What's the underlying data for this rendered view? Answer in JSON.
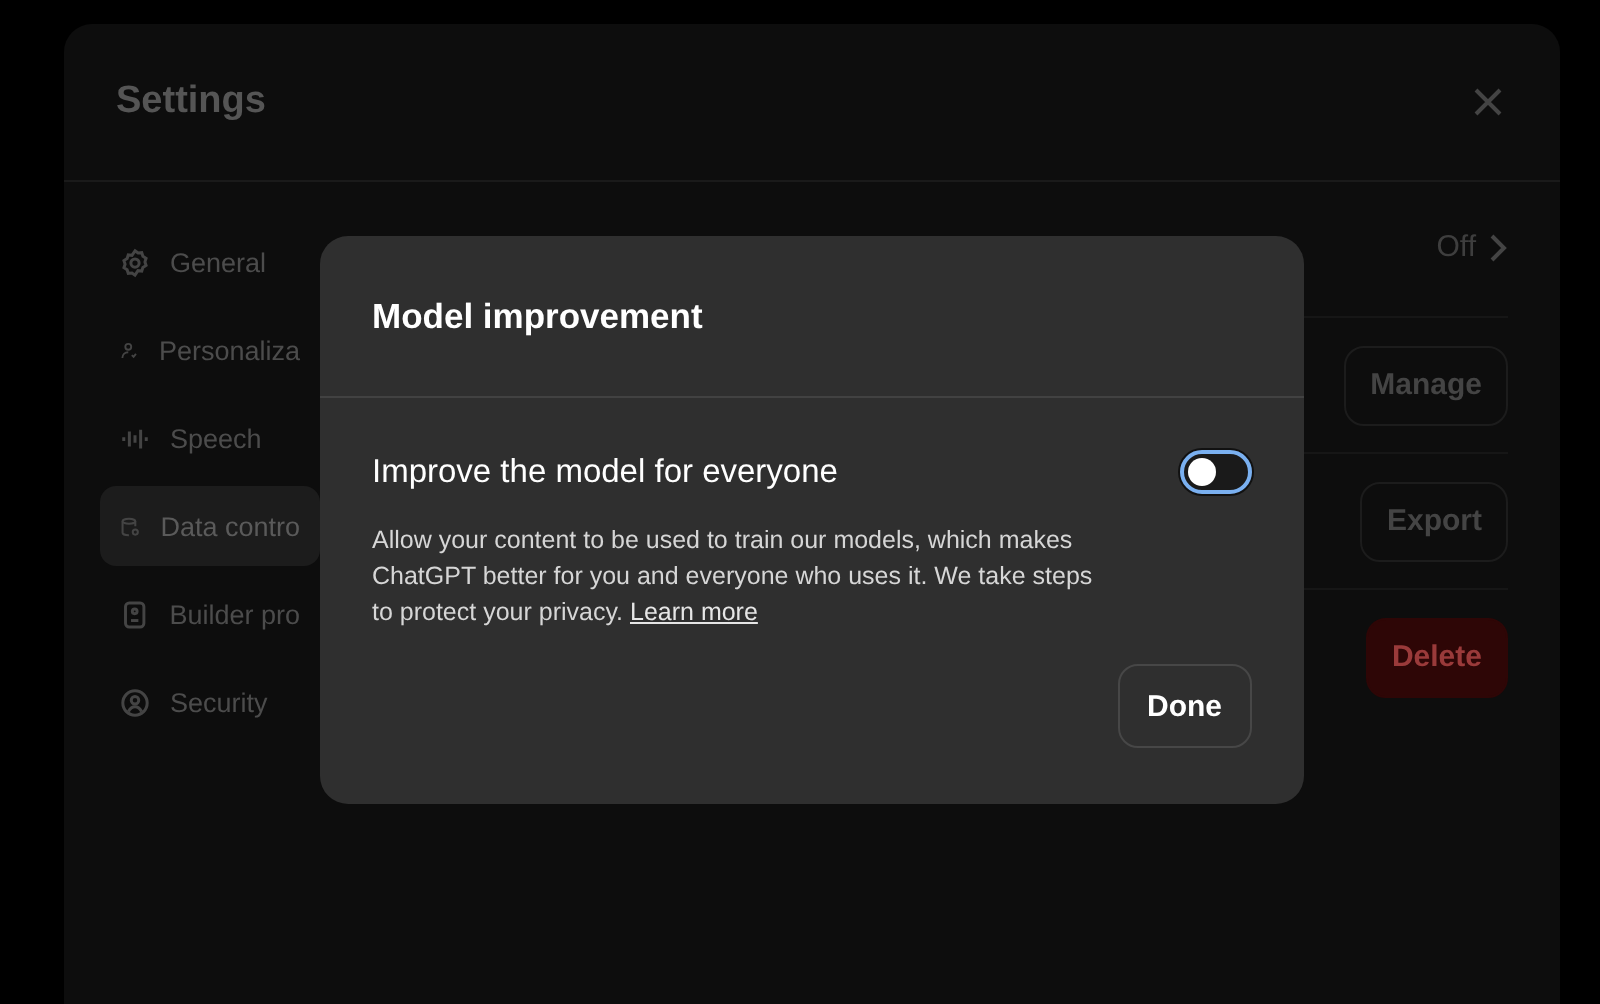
{
  "settings": {
    "title": "Settings",
    "sidebar": {
      "items": [
        {
          "label": "General",
          "selected": false
        },
        {
          "label": "Personaliza",
          "selected": false
        },
        {
          "label": "Speech",
          "selected": false
        },
        {
          "label": "Data contro",
          "selected": true
        },
        {
          "label": "Builder pro",
          "selected": false
        },
        {
          "label": "Security",
          "selected": false
        }
      ]
    },
    "rows": [
      {
        "kind": "link",
        "label": "Off"
      },
      {
        "kind": "button",
        "label": "Manage"
      },
      {
        "kind": "button",
        "label": "Export"
      },
      {
        "kind": "danger",
        "label": "Delete"
      }
    ]
  },
  "dialog": {
    "title": "Model improvement",
    "toggle": {
      "label": "Improve the model for everyone",
      "on": false
    },
    "description": "Allow your content to be used to train our models, which makes ChatGPT better for you and everyone who uses it. We take steps to protect your privacy.",
    "link": "Learn more",
    "buttons": [
      "Done"
    ]
  }
}
